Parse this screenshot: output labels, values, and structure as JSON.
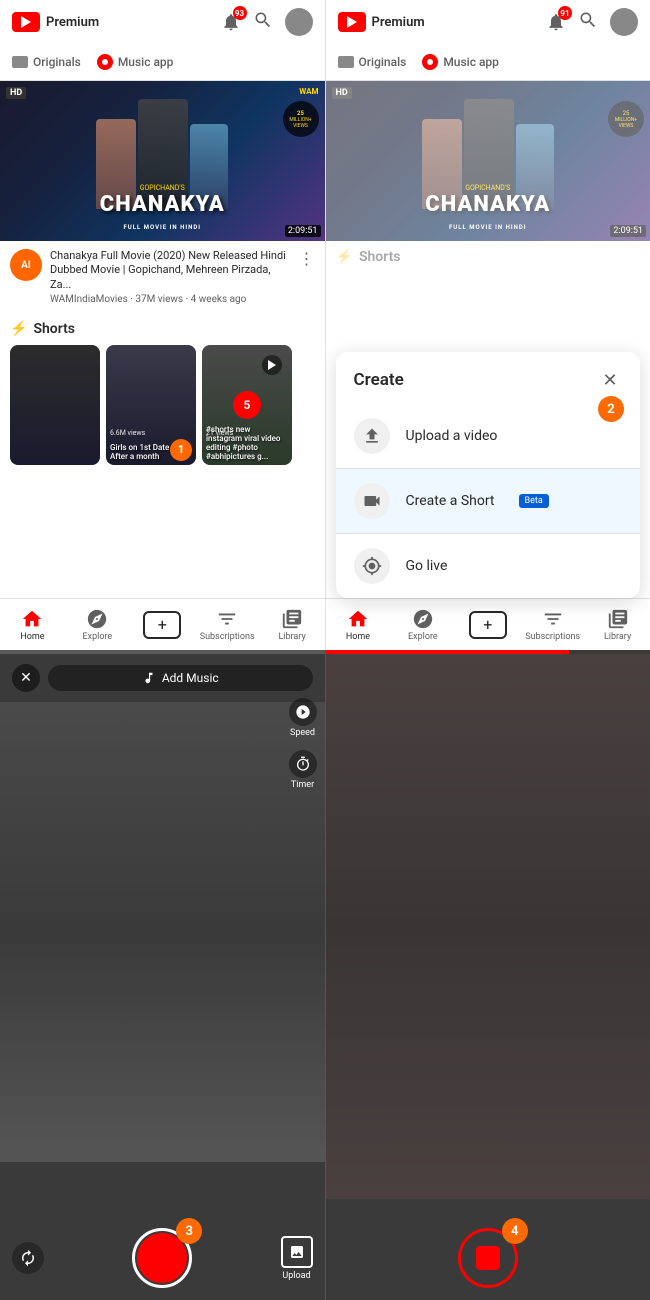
{
  "app": {
    "name": "Premium",
    "logo_alt": "YouTube Premium"
  },
  "header": {
    "notif_count_left": "93",
    "notif_count_right": "91"
  },
  "nav_tabs": {
    "originals": "Originals",
    "music_app": "Music app"
  },
  "video": {
    "hd_badge": "HD",
    "wam_badge": "WAM",
    "views_badge": "25 MILLION+ VIEWS",
    "gopichand": "GOPICHAND'S",
    "title_main": "CHANAKYA",
    "subtitle": "FULL MOVIE IN HINDI",
    "duration": "2:09:51",
    "channel_initials": "AI",
    "description": "Chanakya Full Movie (2020) New Released Hindi Dubbed Movie | Gopichand, Mehreen Pirzada, Za...",
    "channel": "WAMIndiaMovies",
    "views": "37M views",
    "time_ago": "4 weeks ago"
  },
  "shorts": {
    "label": "Shorts",
    "items": [
      {
        "caption": "Girls on 1st Date vs After a month",
        "views": "6.6M views",
        "badge": "1"
      },
      {
        "caption": "#shorts new instagram viral video editing #photo #abhipictures g...",
        "views": "21 views",
        "badge": "5"
      }
    ]
  },
  "bottom_nav": {
    "home": "Home",
    "explore": "Explore",
    "subscriptions": "Subscriptions",
    "library": "Library"
  },
  "create_modal": {
    "title": "Create",
    "upload_video": "Upload a video",
    "create_short": "Create a Short",
    "beta": "Beta",
    "go_live": "Go live",
    "step_badge": "2"
  },
  "camera_left": {
    "add_music": "Add Music",
    "speed": "Speed",
    "timer": "Timer",
    "upload": "Upload",
    "step_badge": "3"
  },
  "camera_right": {
    "step_badge": "4"
  }
}
